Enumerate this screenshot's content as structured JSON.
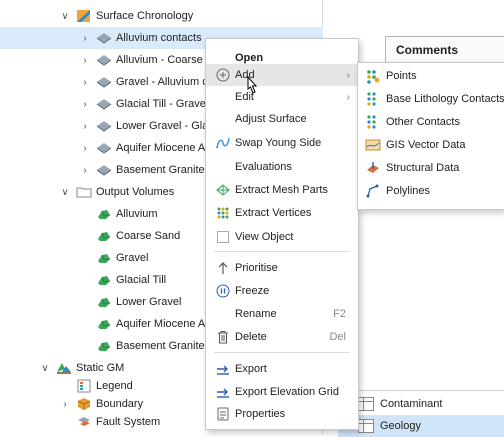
{
  "colors": {
    "selection": "#d9ebfa",
    "accent": "#2a8bd0",
    "green_folder": "#3aa55c"
  },
  "tree": {
    "surface_chronology": "Surface Chronology",
    "alluvium_contacts": "Alluvium contacts",
    "alluvium_coarse": "Alluvium - Coarse S",
    "gravel_alluvium": "Gravel - Alluvium co",
    "glacial_till_gravel": "Glacial Till - Gravel c",
    "lower_gravel_glaci": "Lower Gravel - Glaci",
    "aquifer_miocene": "Aquifer Miocene All",
    "basement_granite_c": "Basement Granite c",
    "output_volumes": "Output Volumes",
    "vol_alluvium": "Alluvium",
    "vol_coarse_sand": "Coarse Sand",
    "vol_gravel": "Gravel",
    "vol_glacial_till": "Glacial Till",
    "vol_lower_gravel": "Lower Gravel",
    "vol_aquifer": "Aquifer Miocene All",
    "vol_basement": "Basement Granite",
    "static_gm": "Static GM",
    "legend": "Legend",
    "boundary": "Boundary",
    "fault_system": "Fault System"
  },
  "comments_header": "Comments",
  "bottom_list": {
    "contaminant": "Contaminant",
    "geology": "Geology"
  },
  "context_menu": {
    "open": "Open",
    "add": "Add",
    "edit": "Edit",
    "adjust_surface": "Adjust Surface",
    "swap_young_side": "Swap Young Side",
    "evaluations": "Evaluations",
    "extract_mesh_parts": "Extract Mesh Parts",
    "extract_vertices": "Extract Vertices",
    "view_object": "View Object",
    "prioritise": "Prioritise",
    "freeze": "Freeze",
    "rename": "Rename",
    "rename_shortcut": "F2",
    "delete": "Delete",
    "delete_shortcut": "Del",
    "export": "Export",
    "export_elevation_grid": "Export Elevation Grid",
    "properties": "Properties"
  },
  "add_submenu": {
    "points": "Points",
    "base_lithology_contacts": "Base Lithology Contacts",
    "other_contacts": "Other Contacts",
    "gis_vector_data": "GIS Vector Data",
    "structural_data": "Structural Data",
    "polylines": "Polylines"
  }
}
